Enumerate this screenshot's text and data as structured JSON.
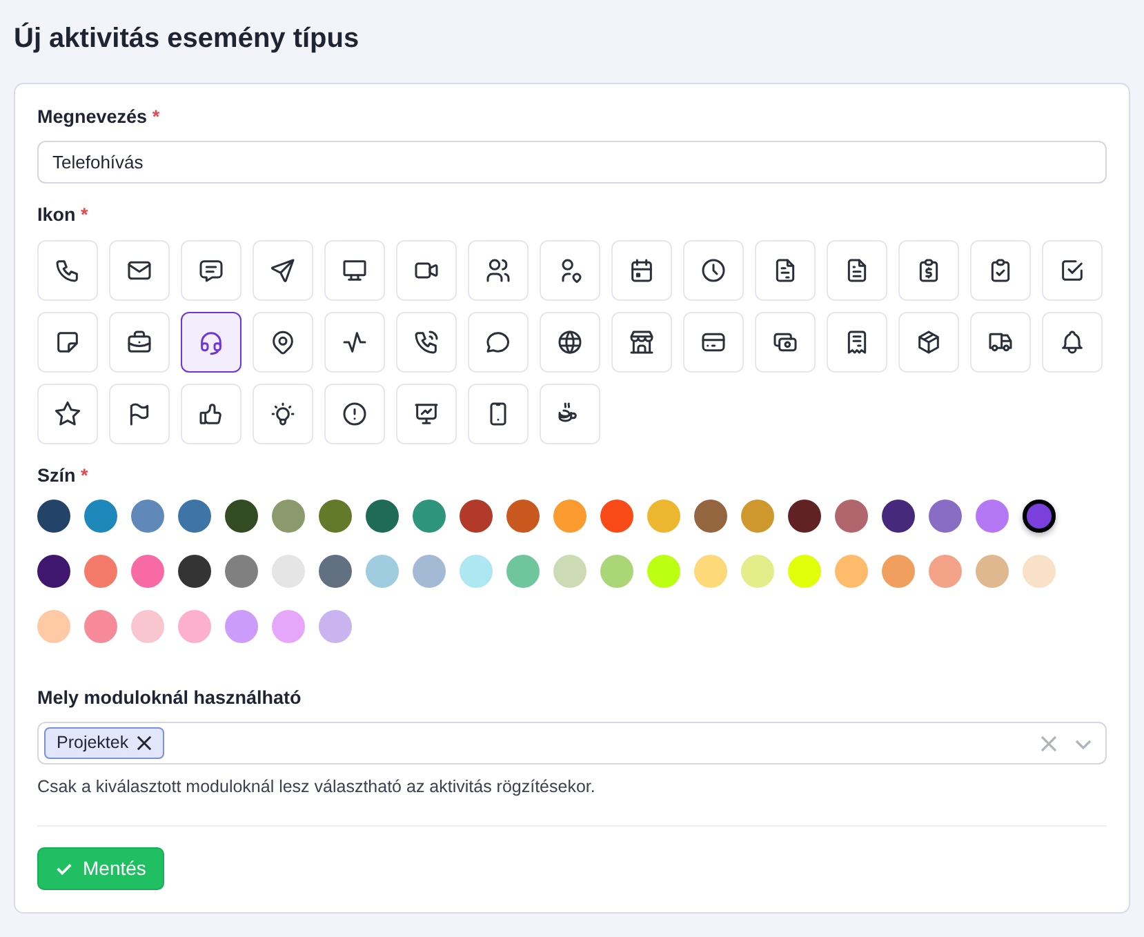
{
  "title": "Új aktivitás esemény típus",
  "name_field": {
    "label": "Megnevezés",
    "required_mark": "*",
    "value": "Telefohívás"
  },
  "icon_field": {
    "label": "Ikon",
    "required_mark": "*",
    "icons": [
      {
        "kind": "phone",
        "selected": false
      },
      {
        "kind": "mail",
        "selected": false
      },
      {
        "kind": "message",
        "selected": false
      },
      {
        "kind": "send",
        "selected": false
      },
      {
        "kind": "monitor",
        "selected": false
      },
      {
        "kind": "video",
        "selected": false
      },
      {
        "kind": "users",
        "selected": false
      },
      {
        "kind": "userpin",
        "selected": false
      },
      {
        "kind": "calendar",
        "selected": false
      },
      {
        "kind": "clock",
        "selected": false
      },
      {
        "kind": "fileminus",
        "selected": false
      },
      {
        "kind": "filetext",
        "selected": false
      },
      {
        "kind": "clipdollar",
        "selected": false
      },
      {
        "kind": "clipcheck",
        "selected": false
      },
      {
        "kind": "checkbox",
        "selected": false
      },
      {
        "kind": "sticky",
        "selected": false
      },
      {
        "kind": "briefcase",
        "selected": false
      },
      {
        "kind": "headset",
        "selected": true
      },
      {
        "kind": "pin",
        "selected": false
      },
      {
        "kind": "activity",
        "selected": false
      },
      {
        "kind": "phonecall",
        "selected": false
      },
      {
        "kind": "bubble",
        "selected": false
      },
      {
        "kind": "globe",
        "selected": false
      },
      {
        "kind": "store",
        "selected": false
      },
      {
        "kind": "card",
        "selected": false
      },
      {
        "kind": "cash",
        "selected": false
      },
      {
        "kind": "receipt",
        "selected": false
      },
      {
        "kind": "package",
        "selected": false
      },
      {
        "kind": "truck",
        "selected": false
      },
      {
        "kind": "bell",
        "selected": false
      },
      {
        "kind": "star",
        "selected": false
      },
      {
        "kind": "flag",
        "selected": false
      },
      {
        "kind": "thumb",
        "selected": false
      },
      {
        "kind": "bulb",
        "selected": false
      },
      {
        "kind": "alert",
        "selected": false
      },
      {
        "kind": "presentation",
        "selected": false
      },
      {
        "kind": "mobile",
        "selected": false
      },
      {
        "kind": "coffee",
        "selected": false
      }
    ]
  },
  "color_field": {
    "label": "Szín",
    "required_mark": "*",
    "swatches": [
      {
        "color": "#234468",
        "selected": false
      },
      {
        "color": "#1e88ba",
        "selected": false
      },
      {
        "color": "#6088b8",
        "selected": false
      },
      {
        "color": "#3e74a6",
        "selected": false
      },
      {
        "color": "#334b22",
        "selected": false
      },
      {
        "color": "#8a9a6c",
        "selected": false
      },
      {
        "color": "#627a2a",
        "selected": false
      },
      {
        "color": "#206a58",
        "selected": false
      },
      {
        "color": "#2e957c",
        "selected": false
      },
      {
        "color": "#b13a2a",
        "selected": false
      },
      {
        "color": "#c8581e",
        "selected": false
      },
      {
        "color": "#f99b2e",
        "selected": false
      },
      {
        "color": "#f84b18",
        "selected": false
      },
      {
        "color": "#ecb72f",
        "selected": false
      },
      {
        "color": "#946640",
        "selected": false
      },
      {
        "color": "#cf982f",
        "selected": false
      },
      {
        "color": "#602222",
        "selected": false
      },
      {
        "color": "#b0666c",
        "selected": false
      },
      {
        "color": "#46297a",
        "selected": false
      },
      {
        "color": "#896cc4",
        "selected": false
      },
      {
        "color": "#b578f5",
        "selected": false
      },
      {
        "color": "#7b3fdb",
        "selected": true
      },
      {
        "color": "#3f176f",
        "selected": false
      },
      {
        "color": "#f47a6a",
        "selected": false
      },
      {
        "color": "#f76aa4",
        "selected": false
      },
      {
        "color": "#343434",
        "selected": false
      },
      {
        "color": "#808080",
        "selected": false
      },
      {
        "color": "#e5e5e5",
        "selected": false
      },
      {
        "color": "#617181",
        "selected": false
      },
      {
        "color": "#a0ccdf",
        "selected": false
      },
      {
        "color": "#a4bad4",
        "selected": false
      },
      {
        "color": "#ade7f2",
        "selected": false
      },
      {
        "color": "#70c69c",
        "selected": false
      },
      {
        "color": "#ccdbb4",
        "selected": false
      },
      {
        "color": "#aad678",
        "selected": false
      },
      {
        "color": "#bcff12",
        "selected": false
      },
      {
        "color": "#fdd97a",
        "selected": false
      },
      {
        "color": "#e3ee8a",
        "selected": false
      },
      {
        "color": "#e1ff0b",
        "selected": false
      },
      {
        "color": "#fdbb6b",
        "selected": false
      },
      {
        "color": "#f19f5e",
        "selected": false
      },
      {
        "color": "#f4a288",
        "selected": false
      },
      {
        "color": "#dfb890",
        "selected": false
      },
      {
        "color": "#f9e1c8",
        "selected": false
      },
      {
        "color": "#fecaa6",
        "selected": false
      },
      {
        "color": "#f78a98",
        "selected": false
      },
      {
        "color": "#f9c6d0",
        "selected": false
      },
      {
        "color": "#fdb0cc",
        "selected": false
      },
      {
        "color": "#cc9cfa",
        "selected": false
      },
      {
        "color": "#e6a7fa",
        "selected": false
      },
      {
        "color": "#c9b4ef",
        "selected": false
      }
    ]
  },
  "modules_field": {
    "label": "Mely moduloknál használható",
    "tags": [
      {
        "label": "Projektek"
      }
    ],
    "help": "Csak a kiválasztott moduloknál lesz választható az aktivitás rögzítésekor."
  },
  "save_button": {
    "label": "Mentés"
  }
}
